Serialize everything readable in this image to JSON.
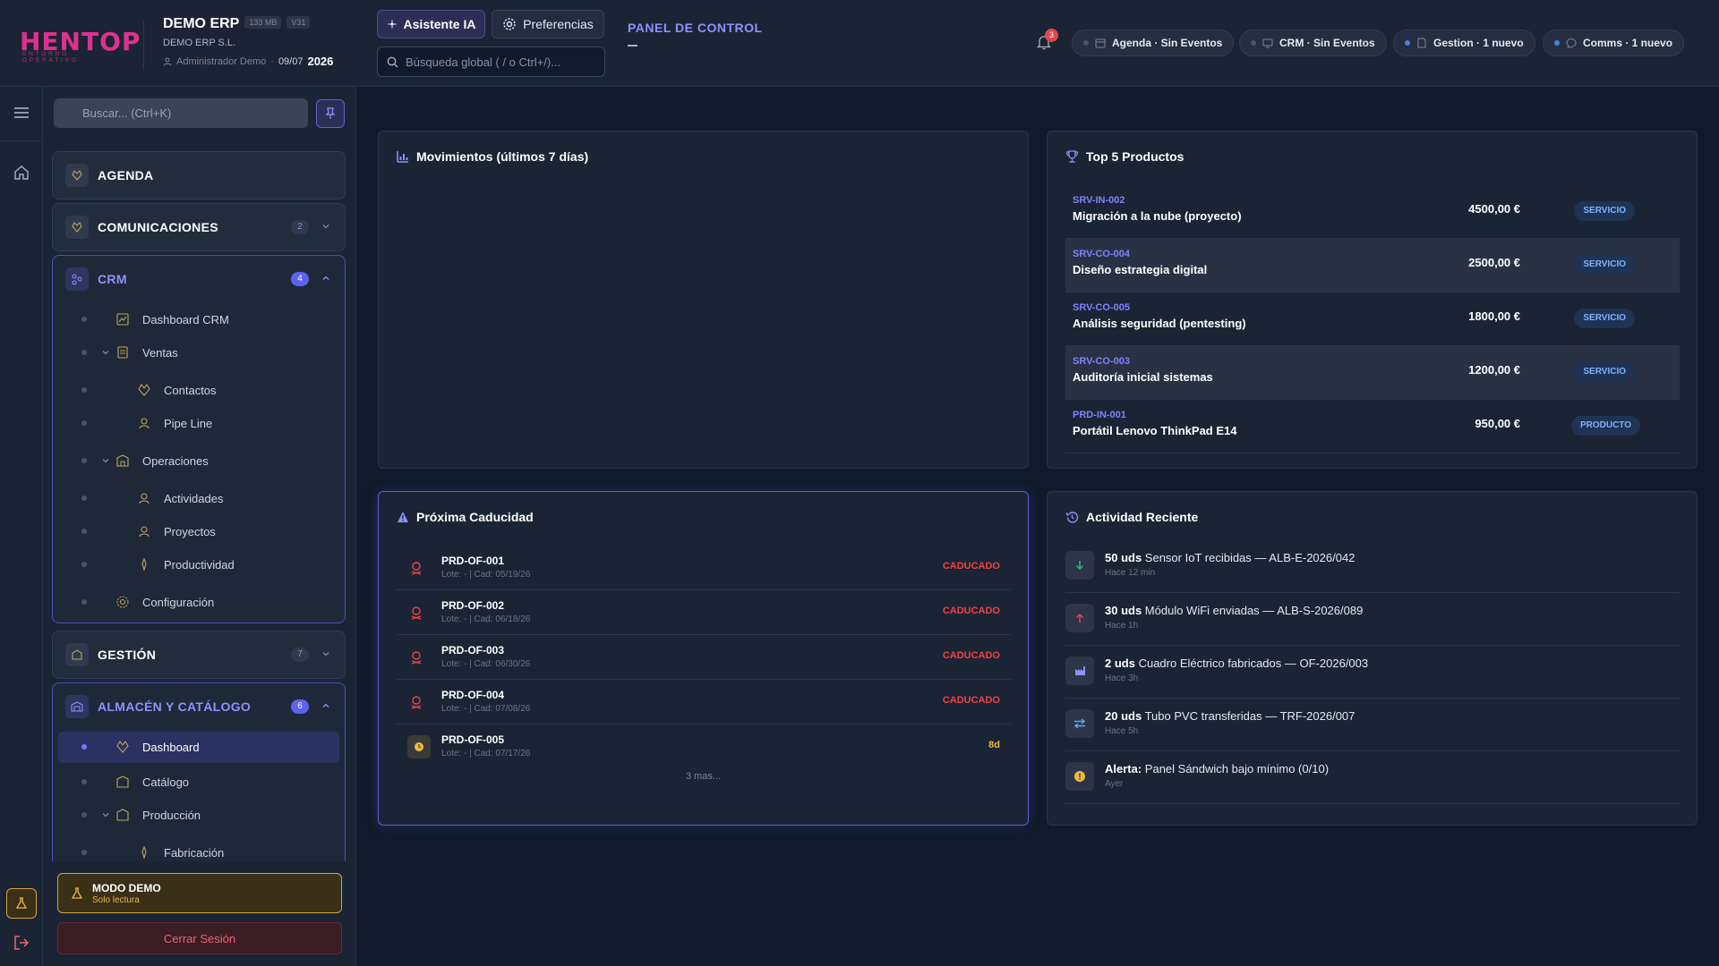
{
  "header": {
    "logo_text": "HENTOP",
    "logo_sub": "ENTORNO OPERATIVO",
    "company_name": "DEMO ERP",
    "memory": "133 MB",
    "version": "V31",
    "company_legal": "DEMO ERP S.L.",
    "user": "Administrador Demo",
    "date": "09/07",
    "year": "2026",
    "ai_button": "Asistente IA",
    "prefs_button": "Preferencias",
    "search_placeholder": "Búsqueda global ( / o Ctrl+/)...",
    "panel_title": "PANEL DE CONTROL",
    "notif_count": "3",
    "events": [
      {
        "label": "Agenda · Sin Eventos",
        "active": false
      },
      {
        "label": "CRM · Sin Eventos",
        "active": false
      },
      {
        "label": "Gestion · 1 nuevo",
        "active": true
      },
      {
        "label": "Comms · 1 nuevo",
        "active": true
      }
    ]
  },
  "sidebar": {
    "search_placeholder": "Buscar... (Ctrl+K)",
    "sections": {
      "agenda": {
        "label": "AGENDA"
      },
      "comms": {
        "label": "COMUNICACIONES",
        "badge": "2"
      },
      "crm": {
        "label": "CRM",
        "badge": "4"
      },
      "gestion": {
        "label": "GESTIÓN",
        "badge": "7"
      },
      "almacen": {
        "label": "ALMACÉN Y CATÁLOGO",
        "badge": "6"
      }
    },
    "crm_items": [
      "Dashboard CRM",
      "Ventas",
      "Contactos",
      "Pipe Line",
      "Operaciones",
      "Actividades",
      "Proyectos",
      "Productividad",
      "Configuración"
    ],
    "almacen_items": [
      "Dashboard",
      "Catálogo",
      "Producción",
      "Fabricación"
    ],
    "demo_title": "MODO DEMO",
    "demo_sub": "Solo lectura",
    "logout": "Cerrar Sesión"
  },
  "movimientos": {
    "title": "Movimientos (últimos 7 días)"
  },
  "top_products": {
    "title": "Top 5 Productos",
    "rows": [
      {
        "code": "SRV-IN-002",
        "name": "Migración a la nube (proyecto)",
        "price": "4500,00 €",
        "tag": "SERVICIO"
      },
      {
        "code": "SRV-CO-004",
        "name": "Diseño estrategia digital",
        "price": "2500,00 €",
        "tag": "SERVICIO"
      },
      {
        "code": "SRV-CO-005",
        "name": "Análisis seguridad (pentesting)",
        "price": "1800,00 €",
        "tag": "SERVICIO"
      },
      {
        "code": "SRV-CO-003",
        "name": "Auditoría inicial sistemas",
        "price": "1200,00 €",
        "tag": "SERVICIO"
      },
      {
        "code": "PRD-IN-001",
        "name": "Portátil Lenovo ThinkPad E14",
        "price": "950,00 €",
        "tag": "PRODUCTO"
      }
    ]
  },
  "expiry": {
    "title": "Próxima Caducidad",
    "rows": [
      {
        "code": "PRD-OF-001",
        "sub": "Lote: - | Cad: 05/19/26",
        "status": "CADUCADO"
      },
      {
        "code": "PRD-OF-002",
        "sub": "Lote: - | Cad: 06/18/26",
        "status": "CADUCADO"
      },
      {
        "code": "PRD-OF-003",
        "sub": "Lote: - | Cad: 06/30/26",
        "status": "CADUCADO"
      },
      {
        "code": "PRD-OF-004",
        "sub": "Lote: - | Cad: 07/08/26",
        "status": "CADUCADO"
      },
      {
        "code": "PRD-OF-005",
        "sub": "Lote: - | Cad: 07/17/26",
        "status": "8d"
      }
    ],
    "more": "3 mas..."
  },
  "activity": {
    "title": "Actividad Reciente",
    "rows": [
      {
        "bold": "50 uds",
        "text": " Sensor IoT recibidas — ALB-E-2026/042",
        "time": "Hace 12 min"
      },
      {
        "bold": "30 uds",
        "text": " Módulo WiFi enviadas — ALB-S-2026/089",
        "time": "Hace 1h"
      },
      {
        "bold": "2 uds",
        "text": " Cuadro Eléctrico fabricados — OF-2026/003",
        "time": "Hace 3h"
      },
      {
        "bold": "20 uds",
        "text": " Tubo PVC transferidas — TRF-2026/007",
        "time": "Hace 5h"
      },
      {
        "bold": "Alerta:",
        "text": " Panel Sándwich bajo mínimo (0/10)",
        "time": "Ayer"
      }
    ]
  }
}
